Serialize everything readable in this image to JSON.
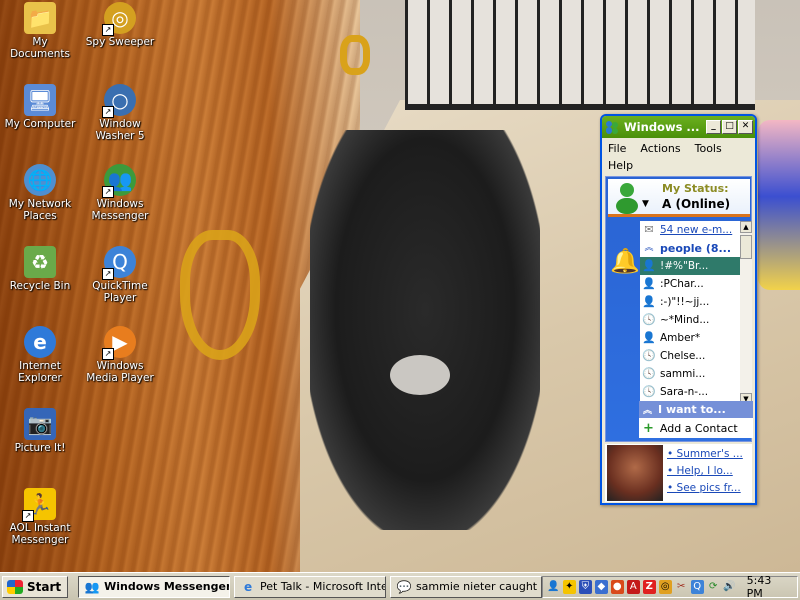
{
  "desktop_icons": [
    {
      "label": "My Documents",
      "icon": "folder-documents-icon",
      "color": "#e9c24a"
    },
    {
      "label": "Spy Sweeper",
      "icon": "spy-sweeper-icon",
      "color": "#d4a020"
    },
    {
      "label": "My Computer",
      "icon": "computer-icon",
      "color": "#5b8bd6"
    },
    {
      "label": "Window Washer 5",
      "icon": "window-washer-icon",
      "color": "#3a6fb0"
    },
    {
      "label": "My Network Places",
      "icon": "network-places-icon",
      "color": "#4e8fd0"
    },
    {
      "label": "Windows Messenger",
      "icon": "messenger-icon",
      "color": "#3c9a3c"
    },
    {
      "label": "Recycle Bin",
      "icon": "recycle-bin-icon",
      "color": "#6aaa4a"
    },
    {
      "label": "QuickTime Player",
      "icon": "quicktime-icon",
      "color": "#3d83d8"
    },
    {
      "label": "Internet Explorer",
      "icon": "internet-explorer-icon",
      "color": "#2f7ad9"
    },
    {
      "label": "Windows Media Player",
      "icon": "media-player-icon",
      "color": "#e87d1e"
    },
    {
      "label": "Picture It!",
      "icon": "picture-it-icon",
      "color": "#3566b8"
    },
    {
      "label": "AOL Instant Messenger",
      "icon": "aim-icon",
      "color": "#f5c400"
    }
  ],
  "messenger": {
    "title": "Windows ...",
    "menu": [
      "File",
      "Actions",
      "Tools",
      "Help"
    ],
    "my_status_label": "My Status:",
    "status_value": "A (Online)",
    "email_link": "54 new e-m...",
    "group_label": "people (8...",
    "contacts": [
      "!#%\"Br...",
      ":PChar...",
      ":-)\"!!~jj...",
      "~*Mind...",
      "Amber*",
      "Chelse...",
      "sammi...",
      "Sara-n-..."
    ],
    "i_want_to": "I want to...",
    "add_contact": "Add a Contact",
    "ad_links": [
      "Summer's ...",
      "Help, I lo...",
      "See pics fr..."
    ]
  },
  "taskbar": {
    "start_label": "Start",
    "tasks": [
      {
        "label": "Windows Messenger",
        "icon": "messenger-icon",
        "active": true
      },
      {
        "label": "Pet Talk - Microsoft Inter...",
        "icon": "internet-explorer-icon",
        "active": false
      },
      {
        "label": "sammie nieter caught a ...",
        "icon": "messenger-chat-icon",
        "active": false
      }
    ],
    "tray_icons": [
      "messenger-tray-icon",
      "aim-tray-icon",
      "shield-tray-icon",
      "security-tray-icon",
      "network-tray-icon",
      "antivirus-tray-icon",
      "zonealarm-tray-icon",
      "spy-sweeper-tray-icon",
      "tools-tray-icon",
      "quicktime-tray-icon",
      "sync-tray-icon",
      "volume-tray-icon"
    ],
    "clock": "5:43 PM"
  }
}
